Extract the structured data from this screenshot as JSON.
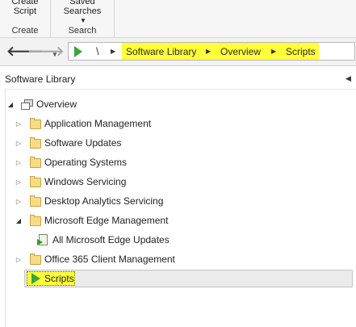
{
  "ribbon": {
    "create_script": [
      "Create",
      "Script"
    ],
    "saved_searches": [
      "Saved",
      "Searches"
    ],
    "group_create": "Create",
    "group_search": "Search"
  },
  "nav": {
    "root_label": "\\",
    "breadcrumbs": [
      "Software Library",
      "Overview",
      "Scripts"
    ],
    "highlight_color": "#ffff3a"
  },
  "pane": {
    "title": "Software Library"
  },
  "tree": {
    "overview": "Overview",
    "items": [
      "Application Management",
      "Software Updates",
      "Operating Systems",
      "Windows Servicing",
      "Desktop Analytics Servicing",
      "Microsoft Edge Management",
      "All Microsoft Edge Updates",
      "Office 365 Client Management",
      "Scripts"
    ]
  },
  "icons": {
    "back": "back-arrow-icon",
    "forward": "forward-arrow-icon",
    "folder": "folder-icon",
    "overview": "overview-icon",
    "updates": "updates-icon",
    "script": "play-icon"
  }
}
